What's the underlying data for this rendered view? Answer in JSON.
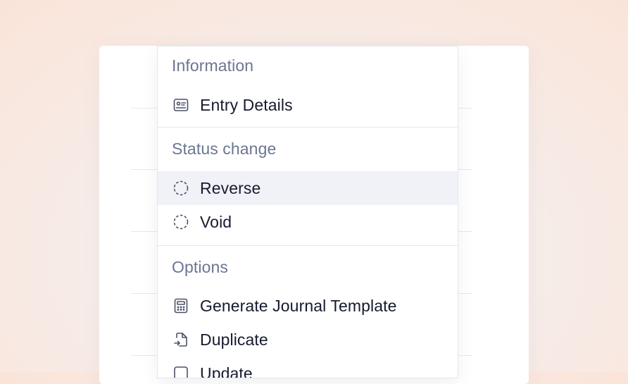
{
  "menu": {
    "sections": [
      {
        "heading": "Information",
        "items": [
          {
            "label": "Entry Details",
            "icon": "id-card-icon"
          }
        ]
      },
      {
        "heading": "Status change",
        "items": [
          {
            "label": "Reverse",
            "icon": "dashed-circle-icon",
            "highlighted": true
          },
          {
            "label": "Void",
            "icon": "dashed-circle-icon"
          }
        ]
      },
      {
        "heading": "Options",
        "items": [
          {
            "label": "Generate Journal Template",
            "icon": "calculator-icon"
          },
          {
            "label": "Duplicate",
            "icon": "file-import-icon"
          },
          {
            "label": "Update",
            "icon": "edit-icon"
          }
        ]
      }
    ]
  },
  "colors": {
    "heading": "#6b7691",
    "label": "#161b2e",
    "icon": "#4a5168",
    "highlight": "#f1f2f7"
  }
}
